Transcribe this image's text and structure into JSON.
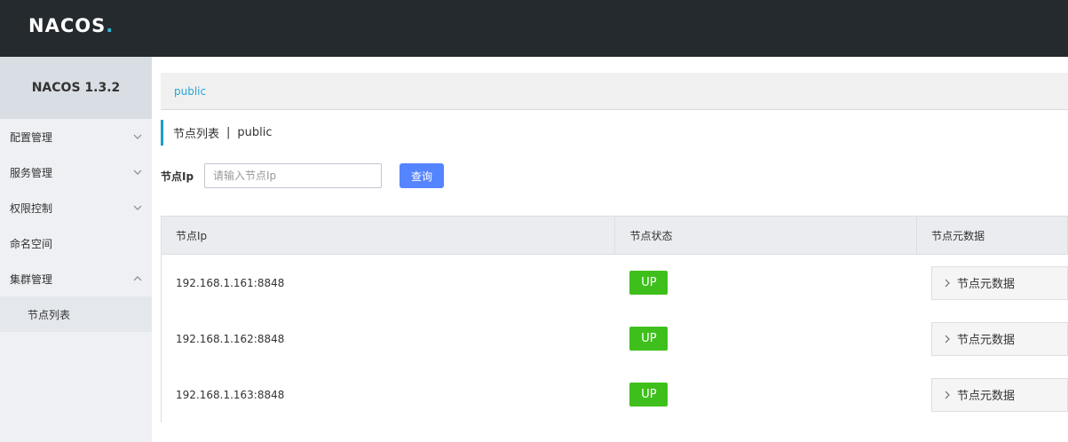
{
  "header": {
    "logo_text": "NACOS",
    "logo_dot": "."
  },
  "sidebar": {
    "version": "NACOS 1.3.2",
    "items": [
      {
        "label": "配置管理",
        "icon": "chevron-down-icon"
      },
      {
        "label": "服务管理",
        "icon": "chevron-down-icon"
      },
      {
        "label": "权限控制",
        "icon": "chevron-down-icon"
      },
      {
        "label": "命名空间"
      },
      {
        "label": "集群管理",
        "icon": "chevron-up-icon"
      }
    ],
    "sub_items": [
      {
        "label": "节点列表"
      }
    ]
  },
  "namespace_bar": {
    "label": "public"
  },
  "page_title": {
    "title": "节点列表",
    "separator": "|",
    "namespace": "public"
  },
  "filter": {
    "label": "节点Ip",
    "placeholder": "请输入节点Ip",
    "value": "",
    "query_label": "查询"
  },
  "table": {
    "headers": [
      "节点Ip",
      "节点状态",
      "节点元数据"
    ],
    "rows": [
      {
        "ip": "192.168.1.161:8848",
        "status": "UP",
        "meta_label": "节点元数据"
      },
      {
        "ip": "192.168.1.162:8848",
        "status": "UP",
        "meta_label": "节点元数据"
      },
      {
        "ip": "192.168.1.163:8848",
        "status": "UP",
        "meta_label": "节点元数据"
      }
    ]
  },
  "colors": {
    "topbar": "#252a2f",
    "accent": "#2ba4d6",
    "primary_button": "#5584ff",
    "status_up": "#3fbf1c"
  }
}
